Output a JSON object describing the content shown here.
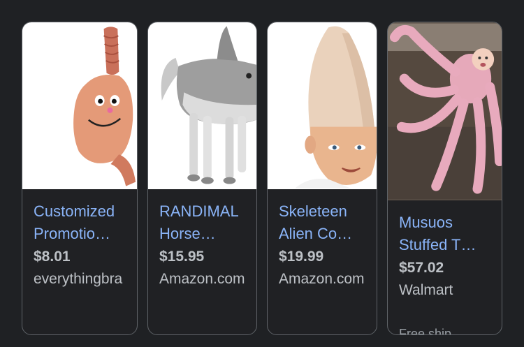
{
  "products": [
    {
      "image_icon": "plush-stomach-mascot-image",
      "title_line1": "Customized",
      "title_line2": "Promotio…",
      "price": "$8.01",
      "seller": "everythingbra"
    },
    {
      "image_icon": "horse-shark-costume-image",
      "title_line1": "RANDIMAL",
      "title_line2": "Horse…",
      "price": "$15.95",
      "seller": "Amazon.com"
    },
    {
      "image_icon": "cone-head-hat-image",
      "title_line1": "Skeleteen",
      "title_line2": "Alien Co…",
      "price": "$19.99",
      "seller": "Amazon.com"
    },
    {
      "image_icon": "octopus-plush-image",
      "title_line1": "Musuos",
      "title_line2": "Stuffed T…",
      "price": "$57.02",
      "seller": "Walmart",
      "extra": "Free ship…"
    }
  ],
  "colors": {
    "background": "#1f2124",
    "title_link": "#8ab4f8",
    "text": "#bdc1c6",
    "border": "#5f6368"
  }
}
